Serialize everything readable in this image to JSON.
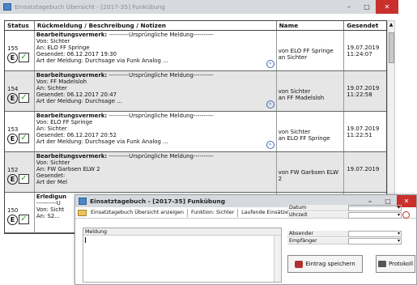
{
  "w1": {
    "title": "Einsatztagebuch Übersicht - [2017-35] Funkübung"
  },
  "headers": [
    "Status",
    "Rückmeldung / Beschreibung / Notizen",
    "Name",
    "Gesendet"
  ],
  "rows": [
    {
      "id": "155",
      "l1": "Bearbeitungsvermerk:",
      "l1b": " ----------Ursprüngliche Meldung----------",
      "l2": "Von: Sichter",
      "l3": "An: ELO FF Springe",
      "l4": "Gesendet: 06.12.2017 19:30",
      "l5": "Art der Meldung: Durchsage via Funk Analog ...",
      "n1": "von ELO FF Springe",
      "n2": "an Sichter",
      "d1": "19.07.2019",
      "d2": "11:24:07",
      "selected": false
    },
    {
      "id": "154",
      "l1": "Bearbeitungsvermerk:",
      "l1b": " ----------Ursprüngliche Meldung----------",
      "l2": "Von: FF Madelsloh",
      "l3": "An: Sichter",
      "l4": "Gesendet: 06.12.2017 20:47",
      "l5": "Art der Meldung: Durchsage ...",
      "n1": "von Sichter",
      "n2": "an FF Madelsloh",
      "d1": "19.07.2019",
      "d2": "11:22:58",
      "selected": true
    },
    {
      "id": "153",
      "l1": "Bearbeitungsvermerk:",
      "l1b": " ----------Ursprüngliche Meldung----------",
      "l2": "Von: ELO FF Springe",
      "l3": "An: Sichter",
      "l4": "Gesendet: 06.12.2017 20:52",
      "l5": "Art der Meldung: Durchsage via Funk Analog ...",
      "n1": "von Sichter",
      "n2": "an ELO FF Springe",
      "d1": "19.07.2019",
      "d2": "11:22:51",
      "selected": false
    },
    {
      "id": "152",
      "l1": "Bearbeitungsvermerk:",
      "l1b": " ----------Ursprüngliche Meldung----------",
      "l2": "Von: Sichter",
      "l3": "An: FW Garbsen ELW 2",
      "l4": "Gesendet:",
      "l5": "Art der Mel",
      "n1": "von FW Garbsen ELW",
      "n2": "2",
      "d1": "19.07.2019",
      "d2": "",
      "selected": true
    },
    {
      "id": "150",
      "l1": "Erledigun",
      "l1b": "",
      "l2": "----------U",
      "l3": "Von: Sicht",
      "l4": "An: S2...",
      "l5": "",
      "n1": "",
      "n2": "",
      "d1": "",
      "d2": "",
      "selected": false
    }
  ],
  "w2": {
    "title": "Einsatztagebuch - [2017-35] Funkübung",
    "tb_overview": "Einsatztagebuch Übersicht anzeigen",
    "tb_function": "Funktion: Sichter",
    "tb_running": "Laufende Einsätze",
    "meldung_label": "Meldung",
    "datum": "Datum",
    "uhrzeit": "Uhrzeit",
    "absender": "Absender",
    "empfaenger": "Empfänger",
    "save": "Eintrag speichern",
    "protokoll": "Protokoll"
  },
  "icons": {
    "status_e": "Ⓔ",
    "check": "✓"
  }
}
